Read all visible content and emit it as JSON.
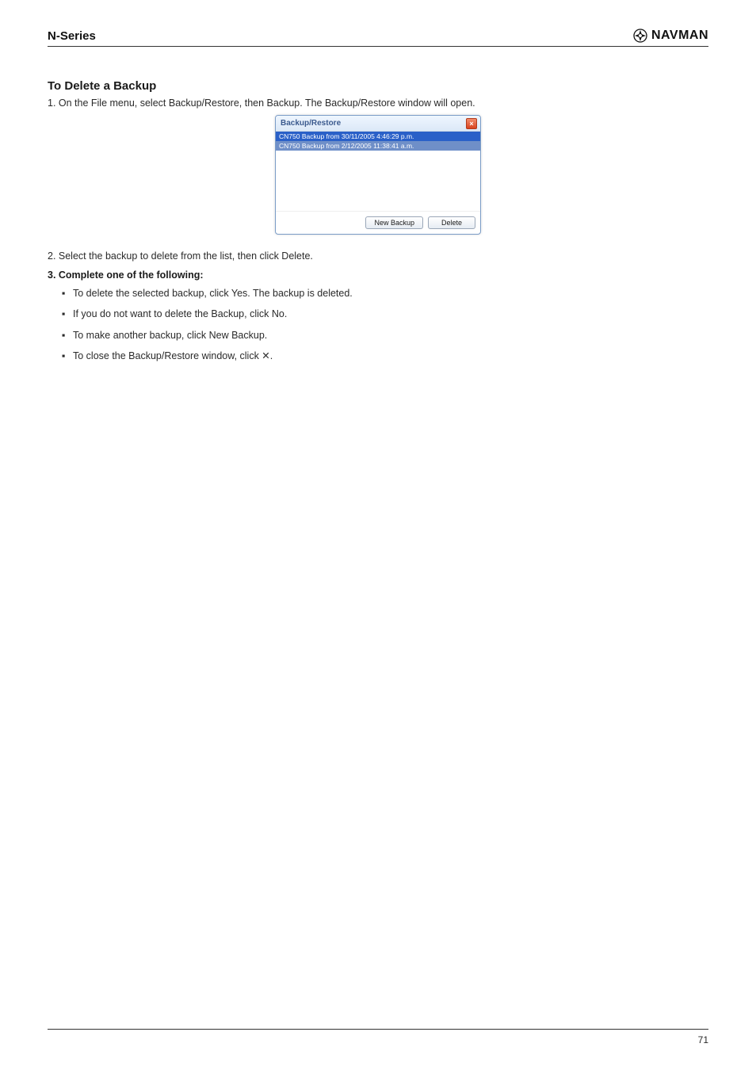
{
  "header": {
    "product_line": "N-Series",
    "brand": "NAVMAN"
  },
  "heading": "To Delete a Backup",
  "line1": "1. On the File menu, select Backup/Restore, then Backup. The Backup/Restore window will open.",
  "dialog": {
    "title": "Backup/Restore",
    "close_glyph": "×",
    "rows": [
      "CN750 Backup from 30/11/2005 4:46:29 p.m.",
      "CN750 Backup from 2/12/2005 11:38:41 a.m."
    ],
    "btn_backup": "New Backup",
    "btn_delete": "Delete"
  },
  "post_dialog": "2. Select the backup to delete from the list, then click Delete.",
  "step_heading": "3. Complete one of the following:",
  "bullets": [
    "To delete the selected backup, click Yes. The backup is deleted.",
    "If you do not want to delete the Backup, click No.",
    "To make another backup, click New Backup.",
    "To close the Backup/Restore window, click ✕."
  ],
  "footer": {
    "page": "71"
  }
}
